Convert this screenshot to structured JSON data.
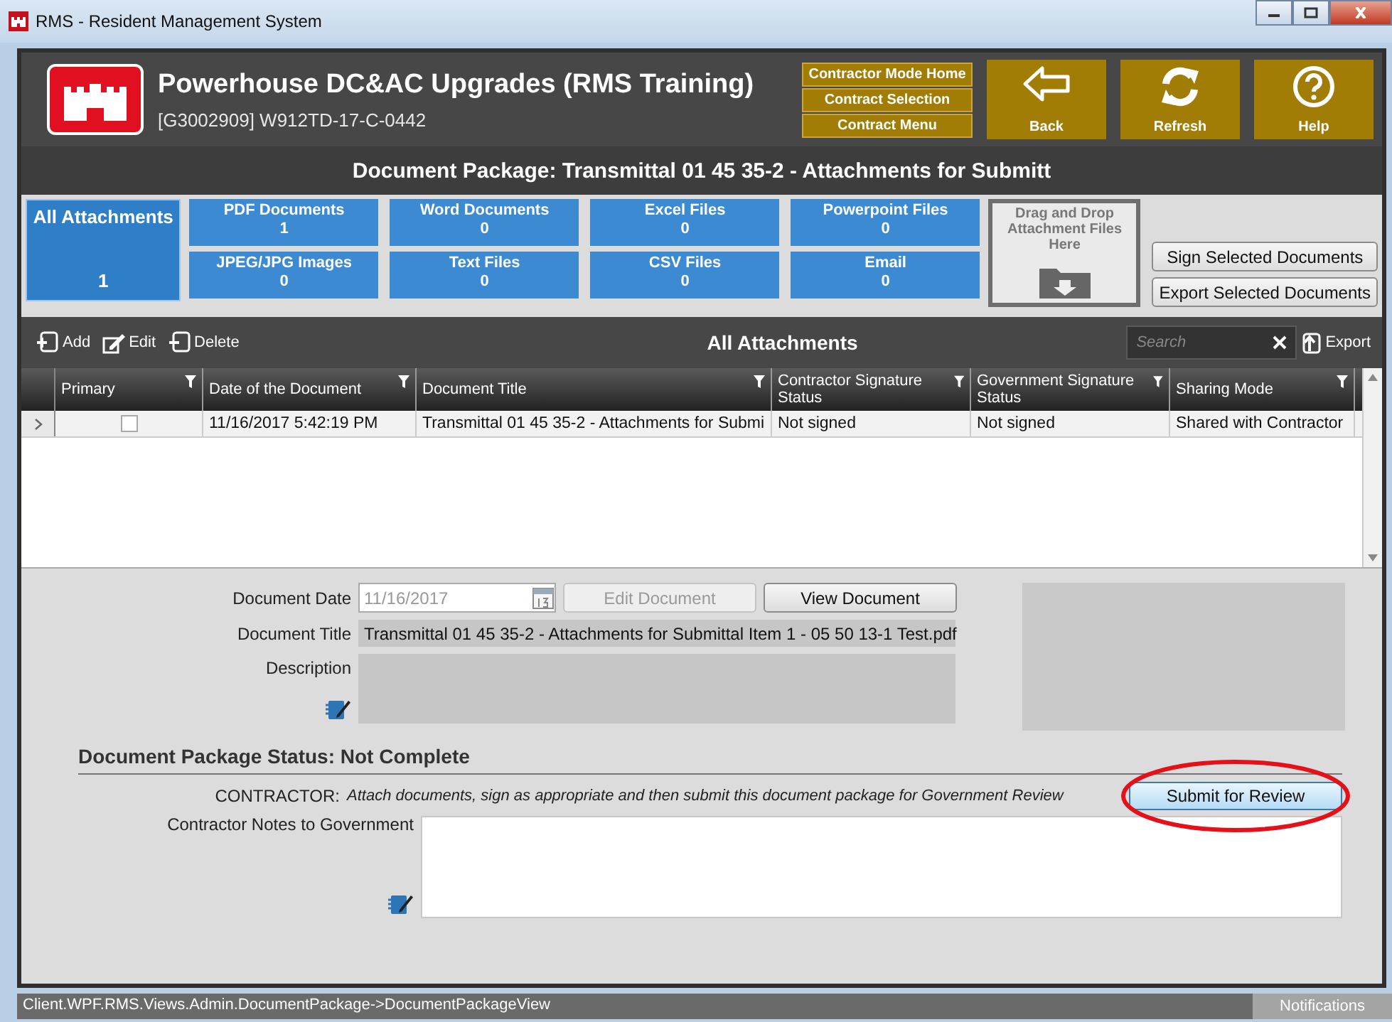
{
  "window": {
    "title": "RMS - Resident Management System"
  },
  "header": {
    "title": "Powerhouse DC&AC Upgrades (RMS Training)",
    "subtitle": "[G3002909] W912TD-17-C-0442",
    "nav_links": [
      "Contractor Mode Home",
      "Contract Selection",
      "Contract Menu"
    ],
    "buttons": [
      {
        "kind": "back",
        "label": "Back"
      },
      {
        "kind": "refresh",
        "label": "Refresh"
      },
      {
        "kind": "help",
        "label": "Help"
      }
    ]
  },
  "package_title": "Document Package: Transmittal 01 45 35-2  -  Attachments for Submitt",
  "all_tile": {
    "label": "All Attachments",
    "count": "1",
    "selected": true
  },
  "tiles": [
    {
      "label": "PDF Documents",
      "count": "1",
      "selected": false
    },
    {
      "label": "Word Documents",
      "count": "0",
      "selected": false
    },
    {
      "label": "Excel Files",
      "count": "0",
      "selected": false
    },
    {
      "label": "Powerpoint Files",
      "count": "0",
      "selected": false
    },
    {
      "label": "JPEG/JPG Images",
      "count": "0",
      "selected": false
    },
    {
      "label": "Text Files",
      "count": "0",
      "selected": false
    },
    {
      "label": "CSV Files",
      "count": "0",
      "selected": false
    },
    {
      "label": "Email",
      "count": "0",
      "selected": false
    }
  ],
  "drop_zone": "Drag and Drop Attachment Files Here",
  "side_buttons": [
    "Sign Selected Documents",
    "Export Selected Documents"
  ],
  "toolbar": {
    "actions": [
      {
        "kind": "add",
        "label": "Add"
      },
      {
        "kind": "edit",
        "label": "Edit"
      },
      {
        "kind": "delete",
        "label": "Delete"
      }
    ],
    "title": "All Attachments",
    "search_placeholder": "Search",
    "export": "Export"
  },
  "table": {
    "columns": [
      "Primary",
      "Date of the Document",
      "Document Title",
      "Contractor Signature Status",
      "Government Signature Status",
      "Sharing Mode"
    ],
    "rows": [
      {
        "selected": true,
        "primary": false,
        "cells": [
          "",
          "11/16/2017 5:42:19 PM",
          "Transmittal 01 45 35-2  -  Attachments for Submi",
          "Not signed",
          "Not signed",
          "Shared with Contractor"
        ]
      }
    ]
  },
  "details": {
    "date_label": "Document Date",
    "date_value": "11/16/2017",
    "edit_button": {
      "label": "Edit Document",
      "disabled": true
    },
    "view_button": {
      "label": "View Document",
      "disabled": false
    },
    "title_label": "Document Title",
    "title_value": "Transmittal 01 45 35-2  -  Attachments for Submittal Item 1 - 05 50 13-1 Test.pdf",
    "description_label": "Description"
  },
  "status": {
    "heading": "Document Package Status: Not Complete",
    "contractor_label": "CONTRACTOR:",
    "instruction": "Attach documents, sign as appropriate and then submit this document package for Government Review",
    "submit_button": "Submit for Review",
    "notes_label": "Contractor Notes to Government"
  },
  "status_bar": {
    "path": "Client.WPF.RMS.Views.Admin.DocumentPackage->DocumentPackageView",
    "notifications": "Notifications"
  }
}
